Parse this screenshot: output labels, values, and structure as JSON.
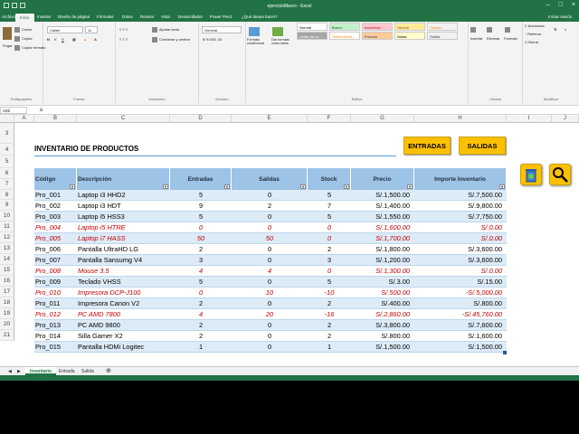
{
  "window": {
    "title": "ejercicioMacro - Excel",
    "signin": "Iniciar sesión"
  },
  "tabs": [
    "Archivo",
    "Inicio",
    "Insertar",
    "Diseño de página",
    "Fórmulas",
    "Datos",
    "Revisar",
    "Vista",
    "Desarrollador",
    "Power Pivot",
    "¿Qué desea hacer?"
  ],
  "ribbon": {
    "clipboard": {
      "paste": "Pegar",
      "cut": "Cortar",
      "copy": "Copiar",
      "format_painter": "Copiar formato",
      "label": "Portapapeles"
    },
    "font": {
      "name": "Calibri",
      "size": "11",
      "label": "Fuente"
    },
    "alignment": {
      "wrap": "Ajustar texto",
      "merge": "Combinar y centrar",
      "label": "Alineación"
    },
    "number": {
      "format": "General",
      "label": "Número"
    },
    "styles": {
      "conditional": "Formato condicional",
      "table": "Dar formato como tabla",
      "cells": [
        "Normal",
        "Bueno",
        "Incorrecto",
        "Neutral",
        "Cálculo",
        "Celda de co...",
        "Celda vincul...",
        "Entrada",
        "Notas",
        "Salida"
      ],
      "label": "Estilos"
    },
    "cells": {
      "insert": "Insertar",
      "delete": "Eliminar",
      "format": "Formato",
      "label": "Celdas"
    },
    "editing": {
      "autosum": "Autosuma",
      "fill": "Rellenar",
      "clear": "Borrar",
      "sort": "Ordenar y filtrar",
      "find": "Buscar y seleccionar",
      "label": "Modificar"
    }
  },
  "formula_bar": {
    "name_box": "A22",
    "fx": "fx"
  },
  "columns": [
    "A",
    "B",
    "C",
    "D",
    "E",
    "F",
    "G",
    "H",
    "I",
    "J"
  ],
  "row_numbers": [
    "3",
    "4",
    "5",
    "6",
    "7",
    "8",
    "9",
    "10",
    "11",
    "12",
    "13",
    "14",
    "15",
    "16",
    "17",
    "18",
    "19",
    "20",
    "21"
  ],
  "sheet": {
    "title": "INVENTARIO DE PRODUCTOS",
    "buttons": {
      "entradas": "ENTRADAS",
      "salidas": "SALIDAS"
    },
    "headers": [
      "Código",
      "Descripción",
      "Entradas",
      "Salidas",
      "Stock",
      "Precio",
      "Importe Inventario"
    ],
    "rows": [
      {
        "code": "Pro_001",
        "desc": "Laptop i3 HHD2",
        "in": "5",
        "out": "0",
        "stock": "5",
        "price": "S/.1,500.00",
        "total": "S/.7,500.00",
        "flag": false
      },
      {
        "code": "Pro_002",
        "desc": "Laptop i3 HDT",
        "in": "9",
        "out": "2",
        "stock": "7",
        "price": "S/.1,400.00",
        "total": "S/.9,800.00",
        "flag": false
      },
      {
        "code": "Pro_003",
        "desc": "Laptop i5 HSS3",
        "in": "5",
        "out": "0",
        "stock": "5",
        "price": "S/.1,550.00",
        "total": "S/.7,750.00",
        "flag": false
      },
      {
        "code": "Pro_004",
        "desc": "Laptop i5 HTRE",
        "in": "0",
        "out": "0",
        "stock": "0",
        "price": "S/.1,600.00",
        "total": "S/.0.00",
        "flag": true
      },
      {
        "code": "Pro_005",
        "desc": "Laptop i7 HASS",
        "in": "50",
        "out": "50",
        "stock": "0",
        "price": "S/.1,700.00",
        "total": "S/.0.00",
        "flag": true
      },
      {
        "code": "Pro_006",
        "desc": "Pantalla UltraHD LG",
        "in": "2",
        "out": "0",
        "stock": "2",
        "price": "S/.1,800.00",
        "total": "S/.3,600.00",
        "flag": false
      },
      {
        "code": "Pro_007",
        "desc": "Pantalla Sansumg V4",
        "in": "3",
        "out": "0",
        "stock": "3",
        "price": "S/.1,200.00",
        "total": "S/.3,600.00",
        "flag": false
      },
      {
        "code": "Pro_008",
        "desc": "Mouse 3.5",
        "in": "4",
        "out": "4",
        "stock": "0",
        "price": "S/.1,300.00",
        "total": "S/.0.00",
        "flag": true
      },
      {
        "code": "Pro_009",
        "desc": "Teclado VHSS",
        "in": "5",
        "out": "0",
        "stock": "5",
        "price": "S/.3.00",
        "total": "S/.15.00",
        "flag": false
      },
      {
        "code": "Pro_010",
        "desc": "Impresora DCP-J100",
        "in": "0",
        "out": "10",
        "stock": "-10",
        "price": "S/.500.00",
        "total": "-S/.5,000.00",
        "flag": true
      },
      {
        "code": "Pro_011",
        "desc": "Impresora Canon V2",
        "in": "2",
        "out": "0",
        "stock": "2",
        "price": "S/.400.00",
        "total": "S/.800.00",
        "flag": false
      },
      {
        "code": "Pro_012",
        "desc": "PC AMD 7800",
        "in": "4",
        "out": "20",
        "stock": "-16",
        "price": "S/.2,860.00",
        "total": "-S/.45,760.00",
        "flag": true
      },
      {
        "code": "Pro_013",
        "desc": "PC AMD 9800",
        "in": "2",
        "out": "0",
        "stock": "2",
        "price": "S/.3,800.00",
        "total": "S/.7,600.00",
        "flag": false
      },
      {
        "code": "Pro_014",
        "desc": "Silla Gamer X2",
        "in": "2",
        "out": "0",
        "stock": "2",
        "price": "S/.800.00",
        "total": "S/.1,600.00",
        "flag": false
      },
      {
        "code": "Pro_015",
        "desc": "Pantalla HDMi Logitec",
        "in": "1",
        "out": "0",
        "stock": "1",
        "price": "S/.1,500.00",
        "total": "S/.1,500.00",
        "flag": false
      }
    ]
  },
  "sheet_tabs": [
    "Inventario",
    "Entrada",
    "Salida"
  ],
  "colors": {
    "accent": "#217346",
    "header_fill": "#9dc3e6",
    "band_fill": "#ddebf7",
    "flag_text": "#c00000",
    "button": "#ffc000"
  }
}
